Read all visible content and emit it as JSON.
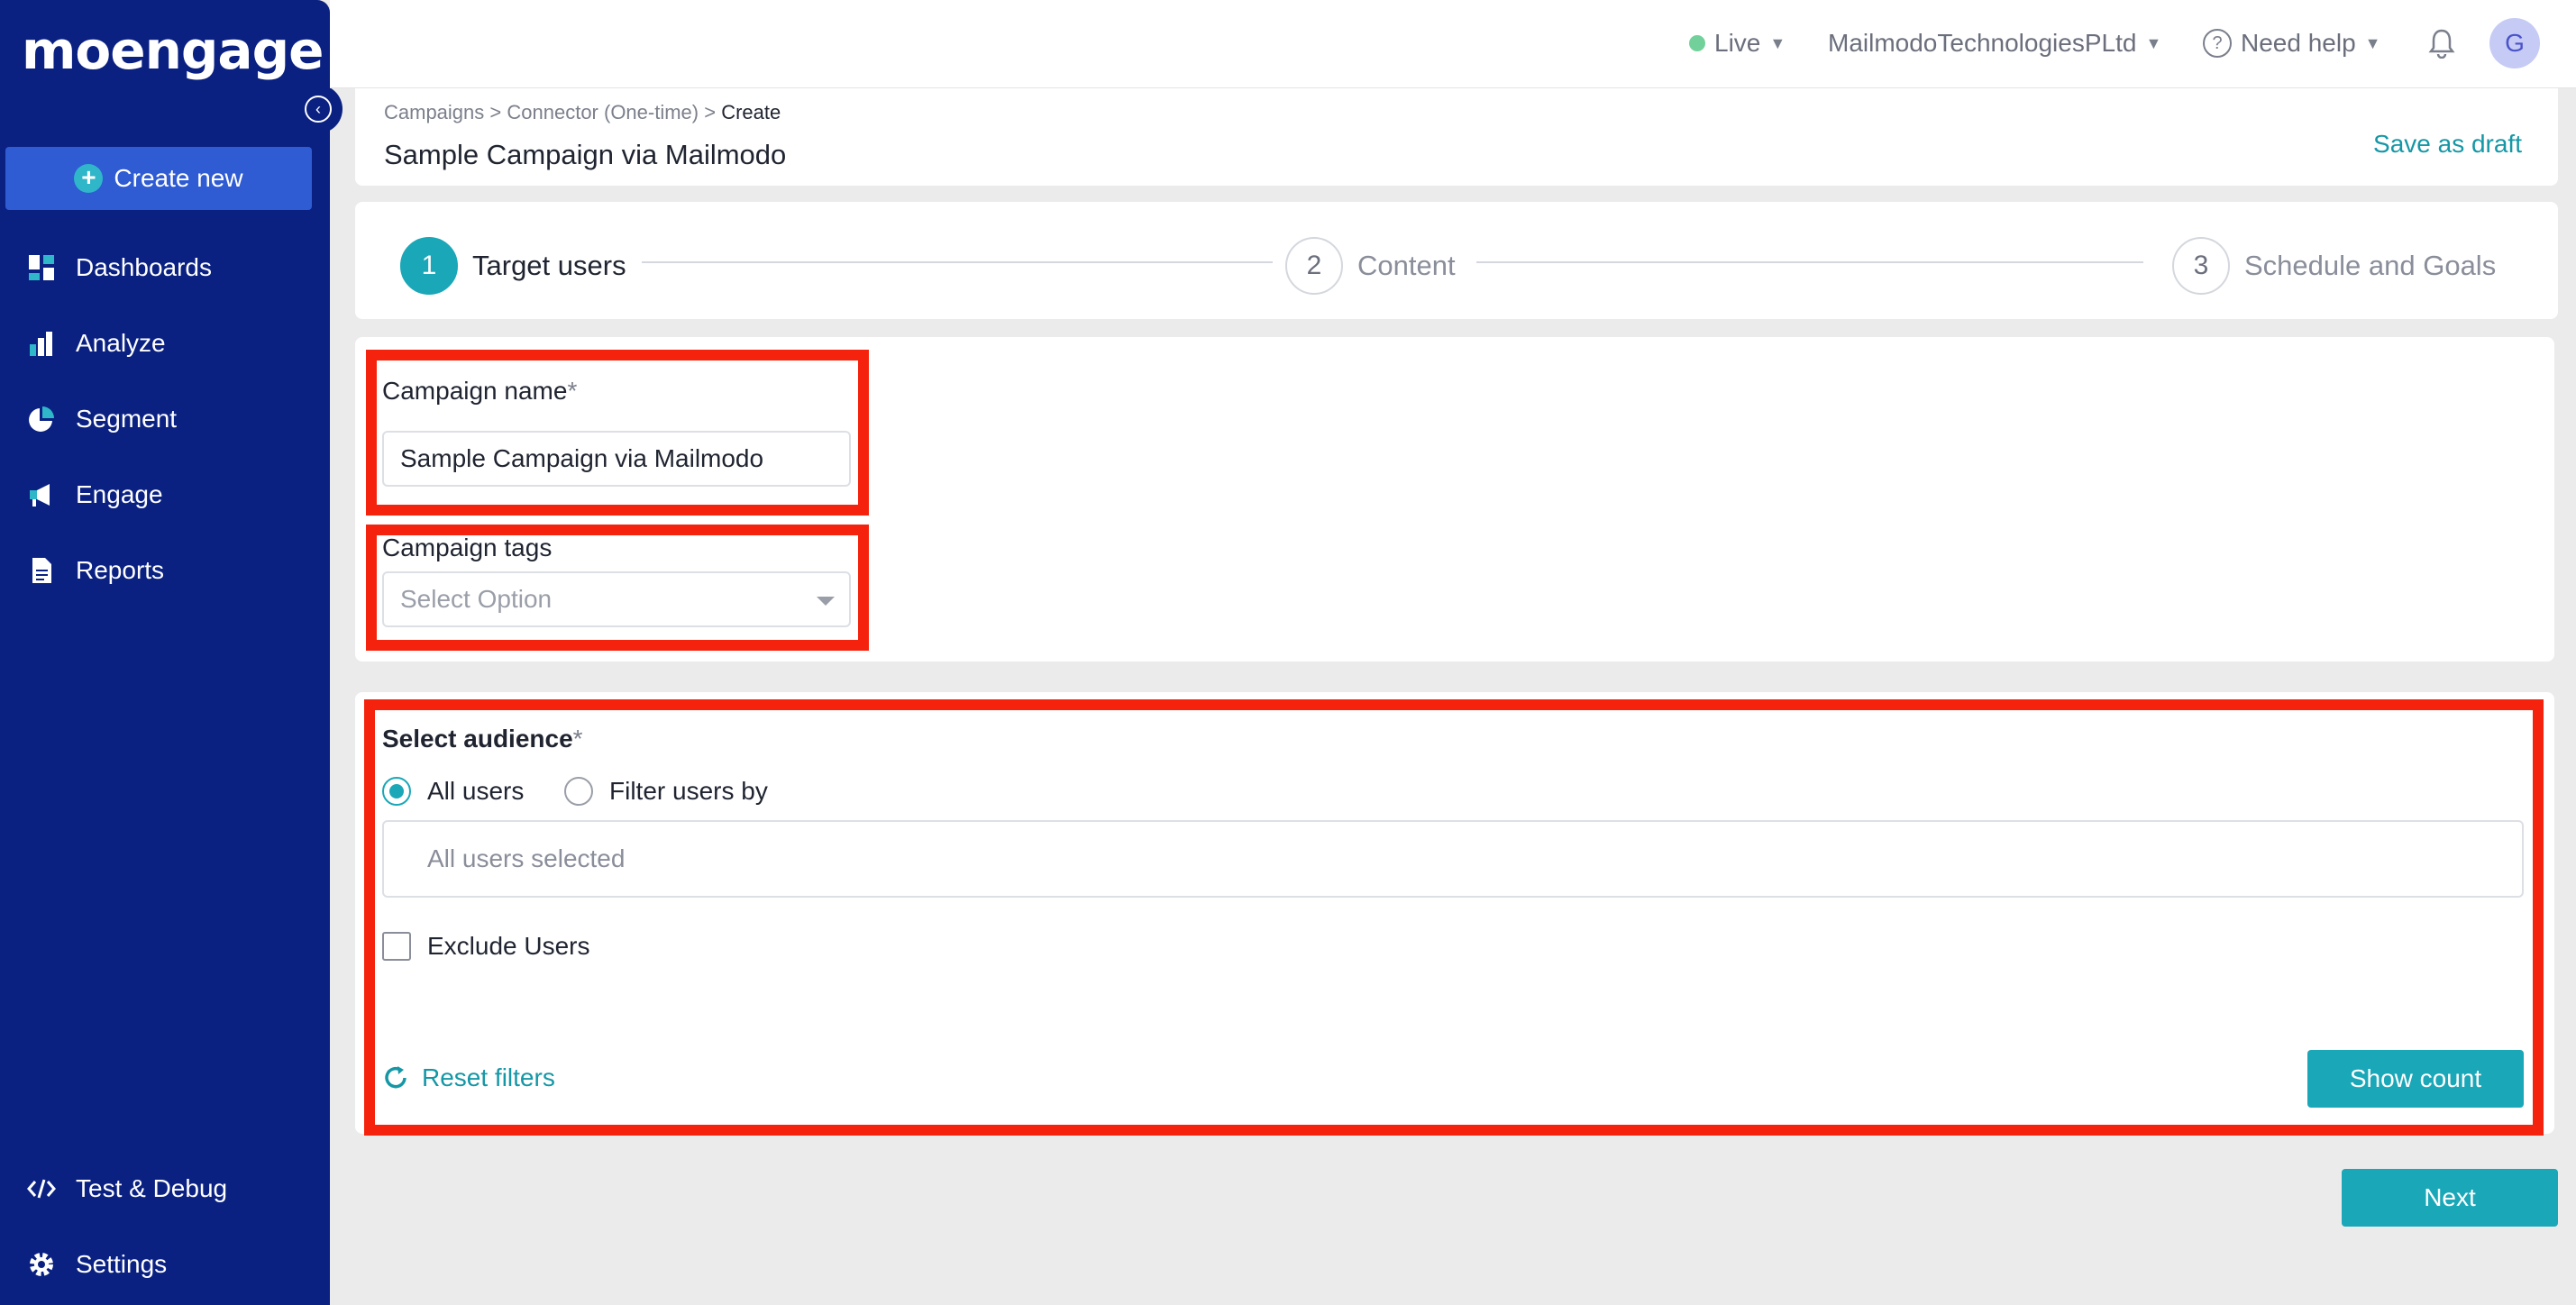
{
  "app": {
    "logo_text": "moengage"
  },
  "sidebar": {
    "create_label": "Create new",
    "items": [
      {
        "label": "Dashboards",
        "icon": "dashboard-icon"
      },
      {
        "label": "Analyze",
        "icon": "bar-chart-icon"
      },
      {
        "label": "Segment",
        "icon": "pie-chart-icon"
      },
      {
        "label": "Engage",
        "icon": "megaphone-icon"
      },
      {
        "label": "Reports",
        "icon": "document-icon"
      }
    ],
    "bottom_items": [
      {
        "label": "Test & Debug",
        "icon": "code-icon"
      },
      {
        "label": "Settings",
        "icon": "gear-icon"
      }
    ]
  },
  "topbar": {
    "env": "Live",
    "workspace": "MailmodoTechnologiesPLtd",
    "help": "Need help",
    "avatar_initial": "G"
  },
  "header": {
    "breadcrumb": [
      "Campaigns",
      "Connector (One-time)",
      "Create"
    ],
    "title": "Sample Campaign via Mailmodo",
    "save_draft": "Save as draft"
  },
  "stepper": {
    "steps": [
      {
        "num": "1",
        "label": "Target users"
      },
      {
        "num": "2",
        "label": "Content"
      },
      {
        "num": "3",
        "label": "Schedule and Goals"
      }
    ]
  },
  "form": {
    "campaign_name_label": "Campaign name",
    "campaign_name_value": "Sample Campaign via Mailmodo",
    "tags_label": "Campaign tags",
    "tags_placeholder": "Select Option"
  },
  "audience": {
    "label": "Select audience",
    "opt_all": "All users",
    "opt_filter": "Filter users by",
    "selected_text": "All users selected",
    "exclude_label": "Exclude Users",
    "reset_label": "Reset filters",
    "show_count_label": "Show count"
  },
  "footer": {
    "next_label": "Next"
  },
  "colors": {
    "sidebar": "#0a2182",
    "accent": "#1aa7b8",
    "highlight": "#f5230d"
  }
}
